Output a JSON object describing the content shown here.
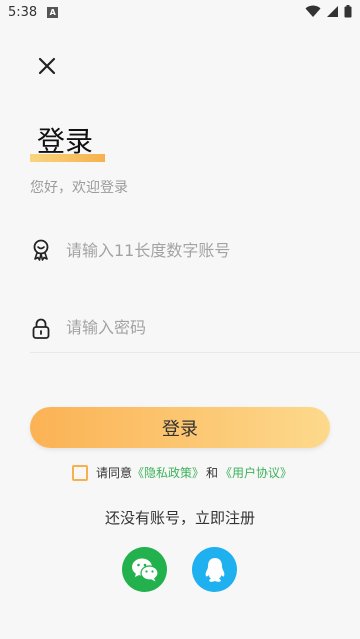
{
  "status_bar": {
    "time": "5:38",
    "notification_letter": "A"
  },
  "header": {
    "title": "登录",
    "subtitle": "您好，欢迎登录"
  },
  "form": {
    "account_placeholder": "请输入11长度数字账号",
    "account_value": "",
    "password_placeholder": "请输入密码",
    "password_value": "",
    "login_label": "登录"
  },
  "agreement": {
    "prefix": "请同意",
    "privacy_link": "《隐私政策》",
    "and": "和",
    "user_link": "《用户协议》"
  },
  "register_text": "还没有账号，立即注册",
  "colors": {
    "accent_orange": "#f6b14d",
    "link_green": "#3db35a",
    "wechat_green": "#22b14c",
    "qq_blue": "#1fb0ef"
  },
  "icons": [
    "close-icon",
    "account-icon",
    "lock-icon",
    "wechat-icon",
    "qq-icon"
  ]
}
